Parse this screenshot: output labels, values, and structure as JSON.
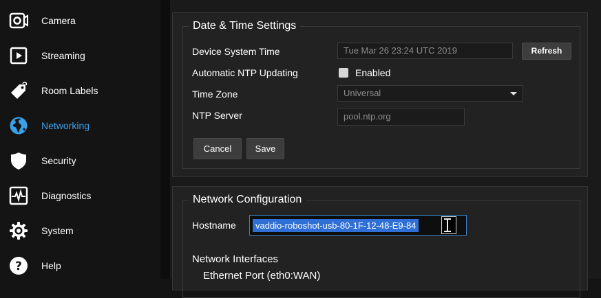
{
  "sidebar": {
    "items": [
      {
        "label": "Camera",
        "icon": "camera-icon"
      },
      {
        "label": "Streaming",
        "icon": "streaming-icon"
      },
      {
        "label": "Room Labels",
        "icon": "tag-icon"
      },
      {
        "label": "Networking",
        "icon": "globe-icon",
        "active": true
      },
      {
        "label": "Security",
        "icon": "shield-icon"
      },
      {
        "label": "Diagnostics",
        "icon": "pulse-icon"
      },
      {
        "label": "System",
        "icon": "gear-icon"
      },
      {
        "label": "Help",
        "icon": "help-icon"
      }
    ],
    "active_color": "#3aa0e8"
  },
  "datetime": {
    "title": "Date & Time Settings",
    "device_time_label": "Device System Time",
    "device_time_value": "Tue Mar 26 23:24 UTC 2019",
    "refresh_label": "Refresh",
    "ntp_updating_label": "Automatic NTP Updating",
    "ntp_enabled_label": "Enabled",
    "timezone_label": "Time Zone",
    "timezone_value": "Universal",
    "ntp_server_label": "NTP Server",
    "ntp_server_placeholder": "pool.ntp.org",
    "cancel_label": "Cancel",
    "save_label": "Save"
  },
  "network": {
    "title": "Network Configuration",
    "hostname_label": "Hostname",
    "hostname_value": "vaddio-roboshot-usb-80-1F-12-48-E9-84",
    "interfaces_label": "Network Interfaces",
    "ethernet_label": "Ethernet Port (eth0:WAN)"
  }
}
